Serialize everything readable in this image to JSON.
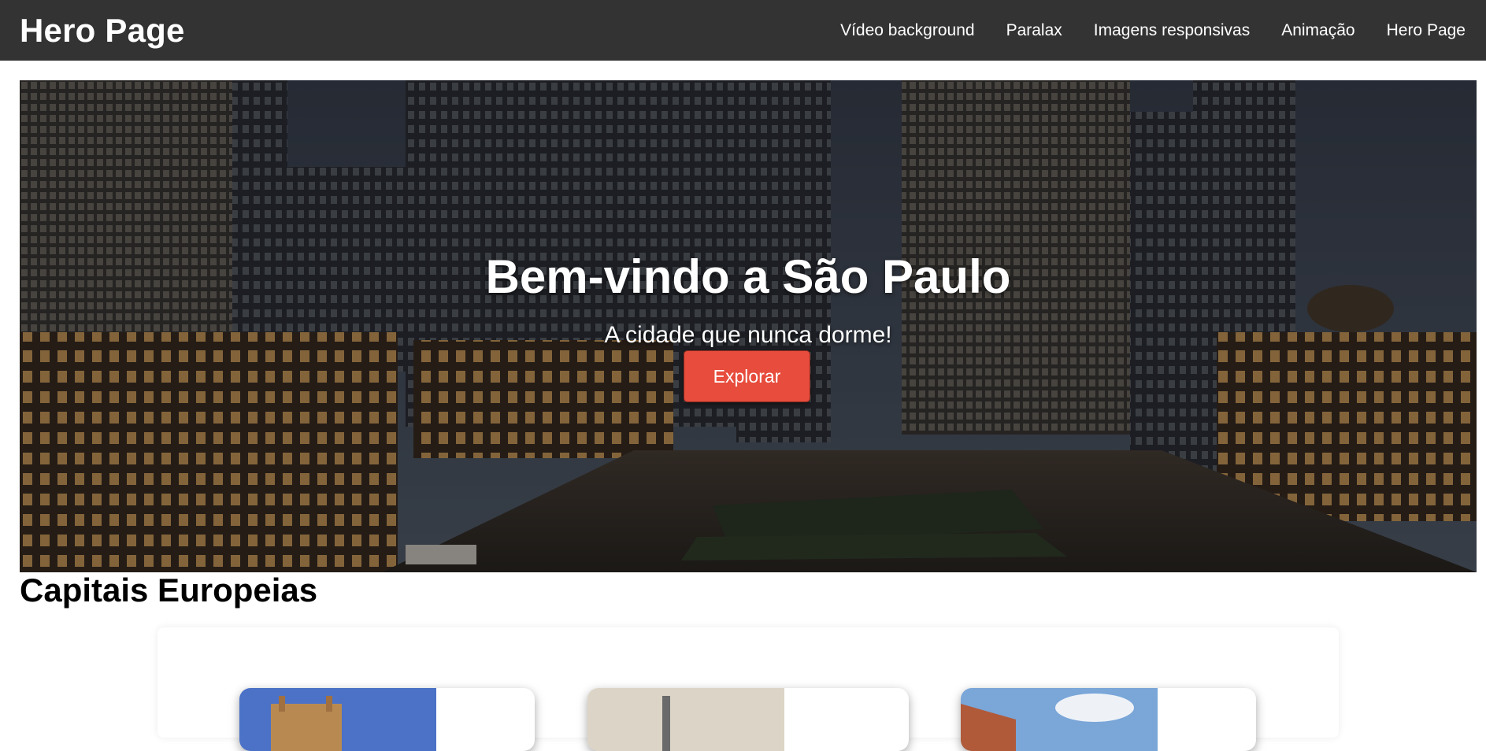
{
  "header": {
    "brand": "Hero Page",
    "nav": [
      {
        "label": "Vídeo background"
      },
      {
        "label": "Paralax"
      },
      {
        "label": "Imagens responsivas"
      },
      {
        "label": "Animação"
      },
      {
        "label": "Hero Page"
      }
    ]
  },
  "hero": {
    "title": "Bem-vindo a São Paulo",
    "subtitle": "A cidade que nunca dorme!",
    "button_label": "Explorar",
    "button_color": "#e74c3c"
  },
  "capitals": {
    "title": "Capitais Europeias",
    "cards": [
      {
        "image": "cathedral-photo"
      },
      {
        "image": "tower-photo"
      },
      {
        "image": "brick-building-photo"
      }
    ]
  },
  "colors": {
    "topbar": "#333333",
    "accent": "#e74c3c"
  }
}
